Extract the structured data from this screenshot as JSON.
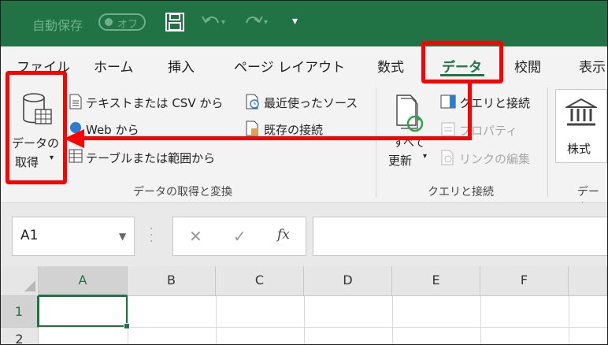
{
  "titlebar": {
    "autosave_label": "自動保存",
    "autosave_state": "オフ",
    "icons": [
      "save-icon",
      "undo-icon",
      "redo-icon",
      "customize-qat-icon"
    ],
    "accent_color": "#217346"
  },
  "tabs": [
    {
      "label": "ファイル"
    },
    {
      "label": "ホーム"
    },
    {
      "label": "挿入"
    },
    {
      "label": "ページ レイアウト"
    },
    {
      "label": "数式"
    },
    {
      "label": "データ",
      "active": true
    },
    {
      "label": "校閲"
    },
    {
      "label": "表示"
    }
  ],
  "ribbon": {
    "get_data": {
      "line1": "データの",
      "line2": "取得"
    },
    "from_text_csv": "テキストまたは CSV から",
    "from_web": "Web から",
    "from_table": "テーブルまたは範囲から",
    "recent_sources": "最近使ったソース",
    "existing_connections": "既存の接続",
    "refresh_all": {
      "line1": "すべて",
      "line2": "更新"
    },
    "queries_connections": "クエリと接続",
    "properties": "プロパティ",
    "edit_links": "リンクの編集",
    "stocks": "株式",
    "group_get_transform": "データの取得と変換",
    "group_queries": "クエリと接続",
    "group_datatypes": "データ"
  },
  "formula_bar": {
    "name_box": "A1",
    "cancel": "✕",
    "enter": "✓",
    "fx": "fx",
    "formula": ""
  },
  "grid": {
    "columns": [
      "A",
      "B",
      "C",
      "D",
      "E",
      "F"
    ],
    "rows": [
      "1",
      "2"
    ],
    "selected_cell": "A1"
  },
  "annotation_color": "#ff0000"
}
